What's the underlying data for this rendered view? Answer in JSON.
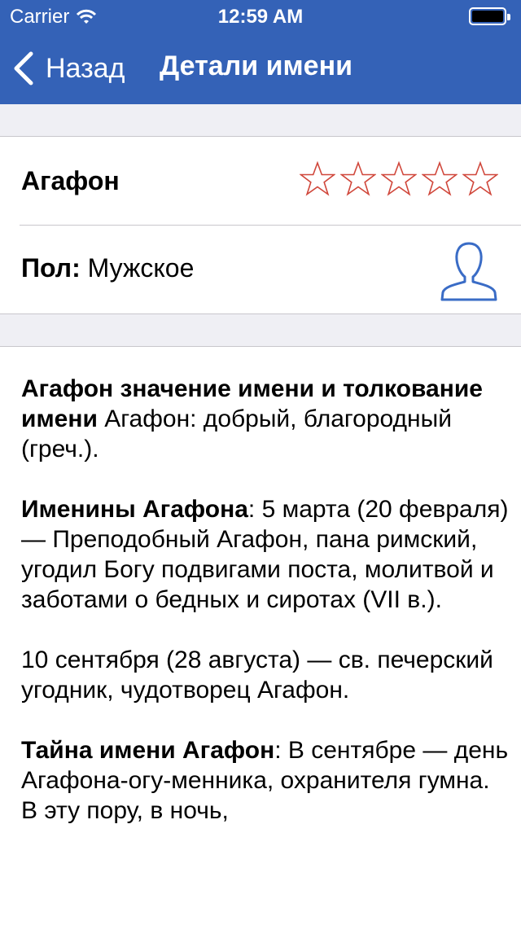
{
  "status_bar": {
    "carrier": "Carrier",
    "time": "12:59 AM"
  },
  "nav": {
    "back_label": "Назад",
    "title": "Детали имени"
  },
  "name_card": {
    "name": "Агафон",
    "rating": {
      "value": 0,
      "max": 5
    },
    "gender_label": "Пол:",
    "gender_value": "Мужское"
  },
  "content": {
    "paragraphs": [
      {
        "bold": "Агафон значение имени и толкование имени",
        "text": " Агафон: добрый, благородный (греч.)."
      },
      {
        "bold": "Именины Агафона",
        "text": ": 5 марта (20 февраля) — Преподобный Агафон, пана римский, угодил Богу подвигами поста, молитвой и заботами о бедных и сиротах (VII в.)."
      },
      {
        "bold": "",
        "text": "10 сентября (28 августа) — св. печерский угодник, чудотворец Агафон."
      },
      {
        "bold": "Тайна имени Агафон",
        "text": ": В сентябре — день Агафона-огу-менника, охранителя гумна. В эту пору, в ночь,"
      }
    ]
  },
  "colors": {
    "nav_bar": "#3462b7",
    "star_outline": "#d0473b",
    "avatar_icon": "#3a6cc6",
    "section_gap": "#efeff4"
  }
}
